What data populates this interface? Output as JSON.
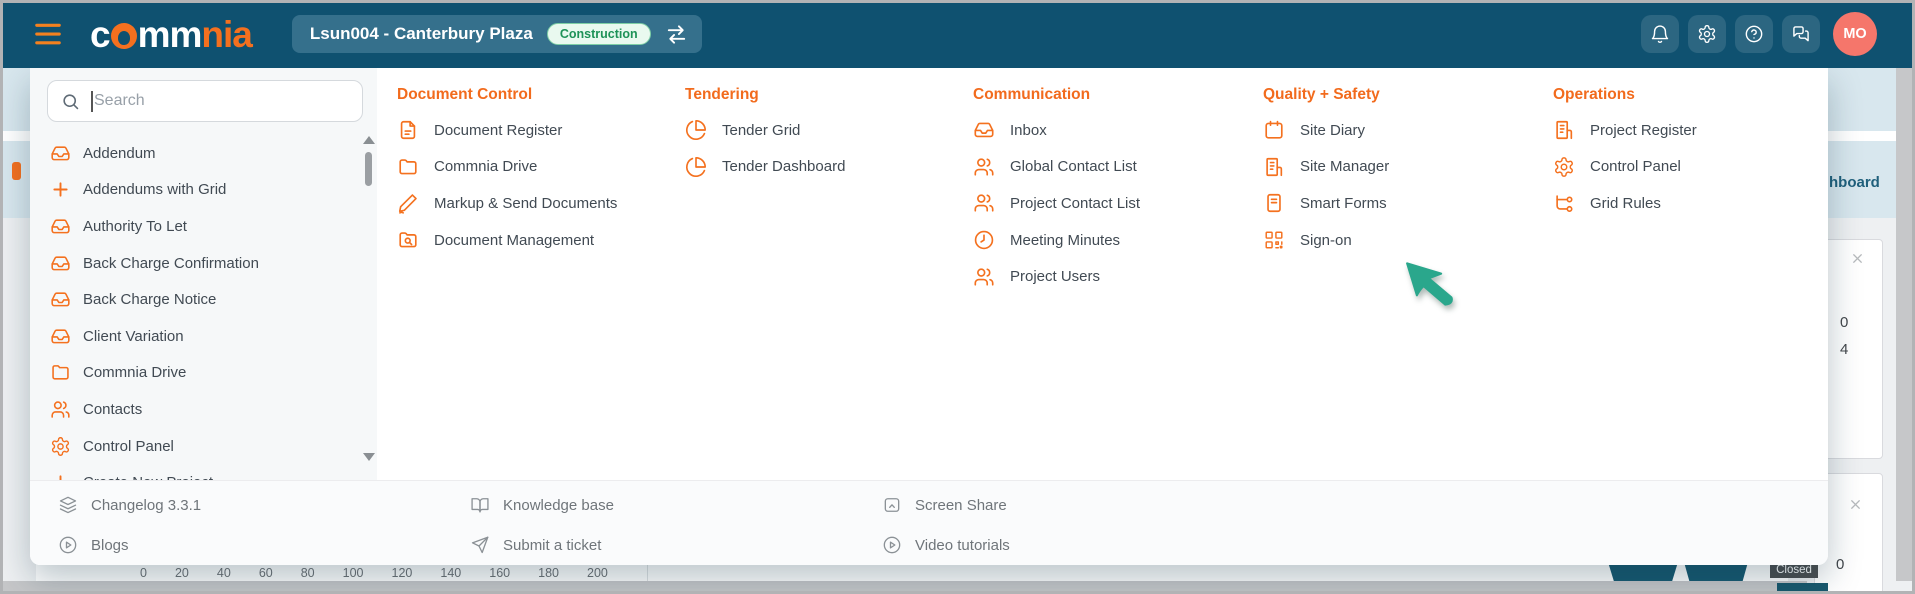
{
  "topbar": {
    "hamburger_icon": "hamburger-menu-icon",
    "logo": {
      "part1": "c",
      "part2": "mm",
      "part3": "nia"
    },
    "project": {
      "name": "Lsun004 - Canterbury Plaza",
      "stage_badge": "Construction",
      "swap_icon": "swap-arrows-icon"
    },
    "actions": [
      {
        "name": "notifications-button",
        "icon": "bell-icon"
      },
      {
        "name": "settings-button",
        "icon": "gear-icon"
      },
      {
        "name": "help-button",
        "icon": "help-circle-icon"
      },
      {
        "name": "chat-button",
        "icon": "chat-bubbles-icon"
      }
    ],
    "avatar": {
      "initials": "MO"
    }
  },
  "menu": {
    "search": {
      "placeholder": "Search",
      "icon": "search-icon"
    },
    "sidebar_items": [
      {
        "label": "Addendum",
        "icon": "inbox-tray-icon",
        "name": "sidebar-item-addendum"
      },
      {
        "label": "Addendums with Grid",
        "icon": "plus-icon",
        "name": "sidebar-item-addendums-with-grid"
      },
      {
        "label": "Authority To Let",
        "icon": "inbox-tray-icon",
        "name": "sidebar-item-authority-to-let"
      },
      {
        "label": "Back Charge Confirmation",
        "icon": "inbox-tray-icon",
        "name": "sidebar-item-back-charge-confirmation"
      },
      {
        "label": "Back Charge Notice",
        "icon": "inbox-tray-icon",
        "name": "sidebar-item-back-charge-notice"
      },
      {
        "label": "Client Variation",
        "icon": "inbox-tray-icon",
        "name": "sidebar-item-client-variation"
      },
      {
        "label": "Commnia Drive",
        "icon": "folder-icon",
        "name": "sidebar-item-commnia-drive"
      },
      {
        "label": "Contacts",
        "icon": "users-icon",
        "name": "sidebar-item-contacts"
      },
      {
        "label": "Control Panel",
        "icon": "gear-icon",
        "name": "sidebar-item-control-panel"
      },
      {
        "label": "Create New Project",
        "icon": "plus-icon",
        "name": "sidebar-item-create-new-project"
      }
    ],
    "columns": [
      {
        "title": "Document Control",
        "items": [
          {
            "label": "Document Register",
            "icon": "file-text-icon",
            "name": "menu-item-document-register"
          },
          {
            "label": "Commnia Drive",
            "icon": "folder-icon",
            "name": "menu-item-commnia-drive"
          },
          {
            "label": "Markup & Send Documents",
            "icon": "pen-icon",
            "name": "menu-item-markup-send-documents"
          },
          {
            "label": "Document Management",
            "icon": "folder-search-icon",
            "name": "menu-item-document-management"
          }
        ]
      },
      {
        "title": "Tendering",
        "items": [
          {
            "label": "Tender Grid",
            "icon": "pie-chart-icon",
            "name": "menu-item-tender-grid"
          },
          {
            "label": "Tender Dashboard",
            "icon": "pie-chart-icon",
            "name": "menu-item-tender-dashboard"
          }
        ]
      },
      {
        "title": "Communication",
        "items": [
          {
            "label": "Inbox",
            "icon": "inbox-tray-icon",
            "name": "menu-item-inbox"
          },
          {
            "label": "Global Contact List",
            "icon": "users-icon",
            "name": "menu-item-global-contact-list"
          },
          {
            "label": "Project Contact List",
            "icon": "users-icon",
            "name": "menu-item-project-contact-list"
          },
          {
            "label": "Meeting Minutes",
            "icon": "clock-icon",
            "name": "menu-item-meeting-minutes"
          },
          {
            "label": "Project Users",
            "icon": "users-icon",
            "name": "menu-item-project-users"
          }
        ]
      },
      {
        "title": "Quality + Safety",
        "items": [
          {
            "label": "Site Diary",
            "icon": "calendar-icon",
            "name": "menu-item-site-diary"
          },
          {
            "label": "Site Manager",
            "icon": "building-icon",
            "name": "menu-item-site-manager"
          },
          {
            "label": "Smart Forms",
            "icon": "form-icon",
            "name": "menu-item-smart-forms"
          },
          {
            "label": "Sign-on",
            "icon": "qr-code-icon",
            "name": "menu-item-sign-on"
          }
        ]
      },
      {
        "title": "Operations",
        "items": [
          {
            "label": "Project Register",
            "icon": "building-icon",
            "name": "menu-item-project-register"
          },
          {
            "label": "Control Panel",
            "icon": "gear-icon",
            "name": "menu-item-control-panel"
          },
          {
            "label": "Grid Rules",
            "icon": "grid-rules-icon",
            "name": "menu-item-grid-rules"
          }
        ]
      }
    ],
    "pointer_icon": "pointer-cursor-icon",
    "footer": {
      "columns": [
        {
          "items": [
            {
              "label": "Changelog 3.3.1",
              "icon": "layers-icon",
              "name": "footer-link-changelog"
            },
            {
              "label": "Blogs",
              "icon": "play-circle-icon",
              "name": "footer-link-blogs"
            }
          ]
        },
        {
          "items": [
            {
              "label": "Knowledge base",
              "icon": "book-open-icon",
              "name": "footer-link-knowledge-base"
            },
            {
              "label": "Submit a ticket",
              "icon": "send-icon",
              "name": "footer-link-submit-ticket"
            }
          ]
        },
        {
          "items": [
            {
              "label": "Screen Share",
              "icon": "screen-share-icon",
              "name": "footer-link-screen-share"
            },
            {
              "label": "Video tutorials",
              "icon": "play-circle-icon",
              "name": "footer-link-video-tutorials"
            }
          ]
        }
      ]
    }
  },
  "background": {
    "tab_fragment": "hboard",
    "close_icon": "close-icon",
    "card1_values": [
      "0",
      "4"
    ],
    "card2_values": [
      "0"
    ],
    "closed_badge": "Closed",
    "axis_ticks": [
      "0",
      "20",
      "40",
      "60",
      "80",
      "100",
      "120",
      "140",
      "160",
      "180",
      "200"
    ]
  },
  "colors": {
    "topbar": "#0f5170",
    "accent_orange": "#f4701f",
    "badge_green": "#1e9257",
    "pointer_green": "#2aa78c",
    "band_blue": "#d8e7ee"
  }
}
